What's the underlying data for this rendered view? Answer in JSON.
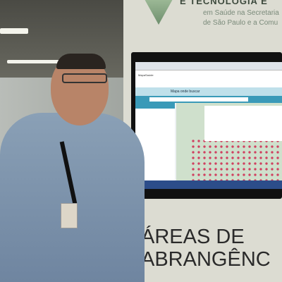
{
  "banner": {
    "line1": "E TECNOLOGIA E",
    "line2": "em Saúde na Secretaria",
    "line3": "de São Paulo e a Comu"
  },
  "sign": {
    "line1": "ÁREAS DE",
    "line2": "ABRANGÊNC"
  },
  "screen": {
    "site": "MapaSaúde",
    "nav": "Mapa onde buscar"
  },
  "colors": {
    "accent": "#3a9ab8",
    "markers": "#d04060"
  }
}
